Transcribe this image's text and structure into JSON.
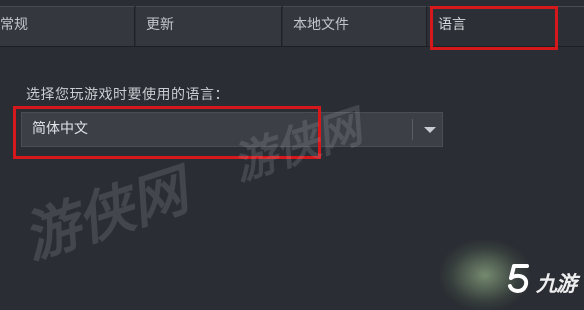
{
  "tabs": [
    {
      "label": "常规"
    },
    {
      "label": "更新"
    },
    {
      "label": "本地文件"
    },
    {
      "label": "语言"
    }
  ],
  "active_tab": "语言",
  "language": {
    "prompt": "选择您玩游戏时要使用的语言：",
    "selected": "简体中文"
  },
  "watermark": {
    "text": "游侠网"
  },
  "brand": {
    "text": "九游"
  },
  "colors": {
    "background": "#2a2d33",
    "tab": "#34373d",
    "dropdown": "#3c3f46",
    "highlight": "#d4181c"
  }
}
